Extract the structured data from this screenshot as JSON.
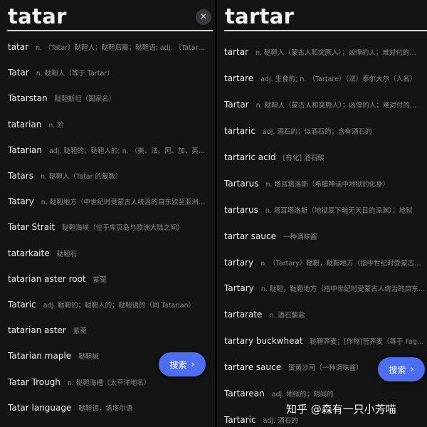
{
  "left": {
    "query": "tatar",
    "clear_icon": "close-icon",
    "clear_label": "×",
    "search_button": "搜索",
    "chevron": "›",
    "results": [
      {
        "word": "tatar",
        "def": "n. （Tatar）鞑靼人；鞑靼后裔；鞑靼语; adj. （Tatar…"
      },
      {
        "word": "Tatar",
        "def": "n. 鞑靼人（等于 Tartar）"
      },
      {
        "word": "Tatarstan",
        "def": "鞑靼斯坦（国家名）"
      },
      {
        "word": "tatarian",
        "def": "n. 阶"
      },
      {
        "word": "Tatarian",
        "def": "adj. 鞑靼的；鞑靼人的; n. （美、法、阿、加、英…"
      },
      {
        "word": "Tatars",
        "def": "n. 鞑靼人（Tatar 的复数）"
      },
      {
        "word": "Tatary",
        "def": "n. 鞑靼地方（中世纪时受蒙古人统治的自东欧至亚洲…"
      },
      {
        "word": "Tatar Strait",
        "def": "鞑靼海峡（位于库页岛与欧洲大陆之间）"
      },
      {
        "word": "tatarkaite",
        "def": "鞑靼石"
      },
      {
        "word": "tatarian aster root",
        "def": "紫菀"
      },
      {
        "word": "Tataric",
        "def": "adj. 鞑靼的；鞑靼人的；鞑靼语的（同 Tatarian）"
      },
      {
        "word": "tatarian aster",
        "def": "紫菀"
      },
      {
        "word": "Tatarian maple",
        "def": "鞑靼槭"
      },
      {
        "word": "Tatar Trough",
        "def": "n. 鞑靼海槽（太平洋地名）"
      },
      {
        "word": "Tatar language",
        "def": "鞑靼语，塔塔尔语"
      }
    ]
  },
  "right": {
    "query": "tartar",
    "search_button": "搜索",
    "chevron": "›",
    "results": [
      {
        "word": "tartar",
        "def": "n. 鞑靼人（蒙古人和突厥人）；凶悍的人；难对付的…"
      },
      {
        "word": "tartare",
        "def": "adj. 生食的; n. （Tartare）（法）泰尔大尔（人名）"
      },
      {
        "word": "Tartar",
        "def": "n. 鞑靼人（蒙古人和突厥人）；凶悍的人；难对付的…"
      },
      {
        "word": "tartaric",
        "def": "adj. 酒石的；似酒石的；含有酒石的"
      },
      {
        "word": "tartaric acid",
        "def": "[有化] 酒石酸"
      },
      {
        "word": "Tartarus",
        "def": "n. 塔耳塔洛斯（希腊神话中地狱的化身）"
      },
      {
        "word": "tartarus",
        "def": "n. 塔耳塔洛斯（地狱底下暗无天日的深渊）；地狱"
      },
      {
        "word": "tartar sauce",
        "def": "一种调味酱"
      },
      {
        "word": "tartary",
        "def": "n. （Tartary）鞑靼，鞑靼地方（指中世纪时受蒙古…"
      },
      {
        "word": "Tartary",
        "def": "n. 鞑靼，鞑靼地方（指中世纪时受蒙古人统治的自东…"
      },
      {
        "word": "tartarate",
        "def": "n. 酒石酸盐"
      },
      {
        "word": "tartary buckwheat",
        "def": "鞑靼荞麦；[作物]苦荞麦（等于 Fagop…"
      },
      {
        "word": "tartare sauce",
        "def": "蛋黄沙司（一种调味酱）"
      },
      {
        "word": "Tartarean",
        "def": "adj. 地狱的；阴间的"
      },
      {
        "word": "Tartaric",
        "def": "adj. 酒石的"
      }
    ]
  },
  "watermark": "知乎 @森有一只小芳喵"
}
